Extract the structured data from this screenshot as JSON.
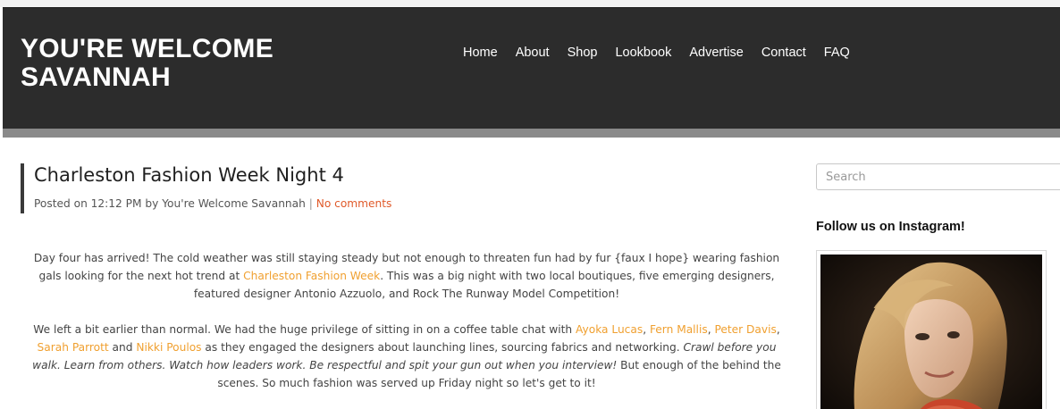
{
  "header": {
    "site_title": "YOU'RE WELCOME SAVANNAH",
    "nav": [
      "Home",
      "About",
      "Shop",
      "Lookbook",
      "Advertise",
      "Contact",
      "FAQ"
    ]
  },
  "post": {
    "title": "Charleston Fashion Week Night 4",
    "meta": {
      "prefix": "Posted on 12:12 PM by You're Welcome Savannah",
      "separator": "|",
      "comments": "No comments"
    },
    "paragraph1": {
      "t1": "Day four has arrived! The cold weather was still staying steady but not enough to threaten fun had by fur {faux I hope} wearing fashion gals looking for the next hot trend at ",
      "link1": "Charleston Fashion Week",
      "t2": ". This was a big night with two local boutiques, five emerging designers, featured designer Antonio Azzuolo, and Rock The Runway Model Competition!"
    },
    "paragraph2": {
      "t1": "We left a bit earlier than normal. We had the huge privilege of sitting in on a coffee table chat with ",
      "link1": "Ayoka Lucas",
      "c1": ", ",
      "link2": "Fern Mallis",
      "c2": ", ",
      "link3": "Peter Davis",
      "c3": ", ",
      "link4": "Sarah Parrott",
      "and": " and ",
      "link5": "Nikki Poulos",
      "t2": " as they engaged the designers about launching lines, sourcing fabrics and networking. ",
      "quote": "Crawl before you walk. Learn from others. Watch how leaders work. Be respectful and spit your gun out when you interview!",
      "t3": " But enough of the behind the scenes. So much fashion was served up Friday night so let's get to it!"
    }
  },
  "sidebar": {
    "search_placeholder": "Search",
    "instagram_title": "Follow us on Instagram!"
  },
  "colors": {
    "header_bg": "#2c2c2c",
    "link_orange": "#f0a030",
    "comment_link": "#e05a2a"
  }
}
